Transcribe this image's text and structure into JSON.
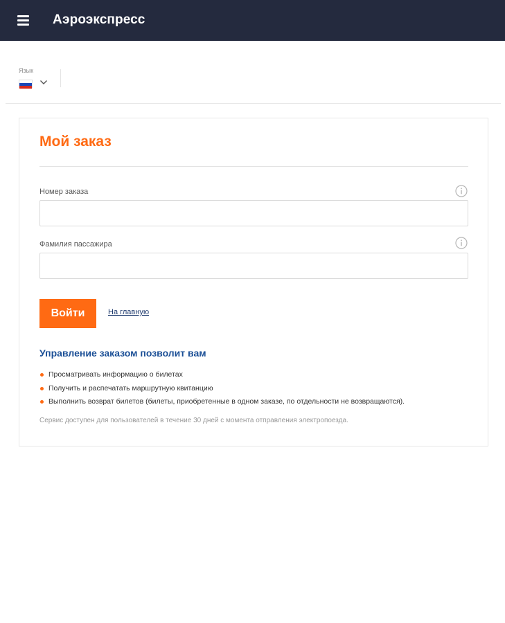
{
  "header": {
    "title": "Аэроэкспресс",
    "background": "#242a3e"
  },
  "language": {
    "label": "Язык",
    "selected_flag": "russia-flag-icon"
  },
  "order_form": {
    "title": "Мой заказ",
    "order_number": {
      "label": "Номер заказа",
      "value": "",
      "placeholder": ""
    },
    "passenger_surname": {
      "label": "Фамилия пассажира",
      "value": "",
      "placeholder": ""
    },
    "login_button": "Войти",
    "home_link": "На главную"
  },
  "info": {
    "title": "Управление заказом позволит вам",
    "items": [
      {
        "text": "Просматривать информацию о билетах"
      },
      {
        "text": "Получить и распечатать маршрутную квитанцию"
      },
      {
        "text": "Выполнить возврат билетов (билеты, приобретенные в одном заказе, по отдельности не возвращаются)."
      }
    ],
    "note": "Сервис доступен для пользователей в течение 30 дней с момента отправления электропоезда."
  },
  "colors": {
    "accent": "#ff6a13",
    "link": "#1b4f96"
  }
}
